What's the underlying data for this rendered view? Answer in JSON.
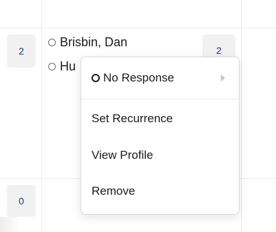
{
  "rows": [
    {
      "count": "2",
      "people": [
        {
          "name": "Brisbin, Dan"
        },
        {
          "name": "Hu"
        }
      ],
      "secondary_count": "2"
    },
    {
      "count": "0"
    }
  ],
  "context_menu": {
    "response_label": "No Response",
    "items": [
      {
        "label": "Set Recurrence"
      },
      {
        "label": "View Profile"
      },
      {
        "label": "Remove"
      }
    ]
  }
}
